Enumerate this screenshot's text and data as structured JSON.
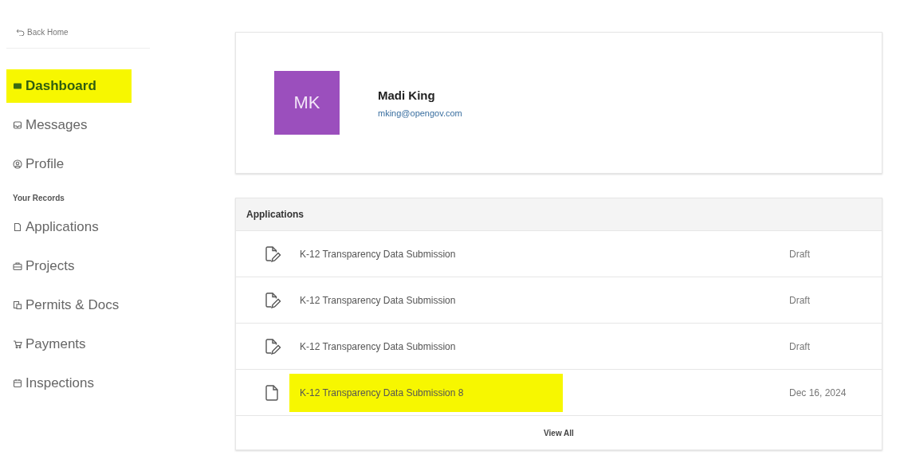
{
  "sidebar": {
    "back_link": "Back Home",
    "items": [
      {
        "label": "Dashboard",
        "kind": "dashboard",
        "selected": true,
        "highlighted": true
      },
      {
        "label": "Messages",
        "kind": "messages",
        "selected": false,
        "highlighted": false
      },
      {
        "label": "Profile",
        "kind": "profile",
        "selected": false,
        "highlighted": false
      }
    ],
    "section_title": "Your Records",
    "records": [
      {
        "label": "Applications",
        "kind": "applications"
      },
      {
        "label": "Projects",
        "kind": "projects"
      },
      {
        "label": "Permits & Docs",
        "kind": "permits"
      },
      {
        "label": "Payments",
        "kind": "payments"
      },
      {
        "label": "Inspections",
        "kind": "inspections"
      }
    ]
  },
  "profile": {
    "initials": "MK",
    "name": "Madi King",
    "email": "mking@opengov.com"
  },
  "applications": {
    "title": "Applications",
    "rows": [
      {
        "kind": "draft",
        "title": "K-12 Transparency Data Submission",
        "status": "Draft",
        "highlighted": false
      },
      {
        "kind": "draft",
        "title": "K-12 Transparency Data Submission",
        "status": "Draft",
        "highlighted": false
      },
      {
        "kind": "draft",
        "title": "K-12 Transparency Data Submission",
        "status": "Draft",
        "highlighted": false
      },
      {
        "kind": "submitted",
        "title": "K-12 Transparency Data Submission 8",
        "status": "Dec 16, 2024",
        "highlighted": true
      }
    ],
    "view_all": "View All"
  }
}
